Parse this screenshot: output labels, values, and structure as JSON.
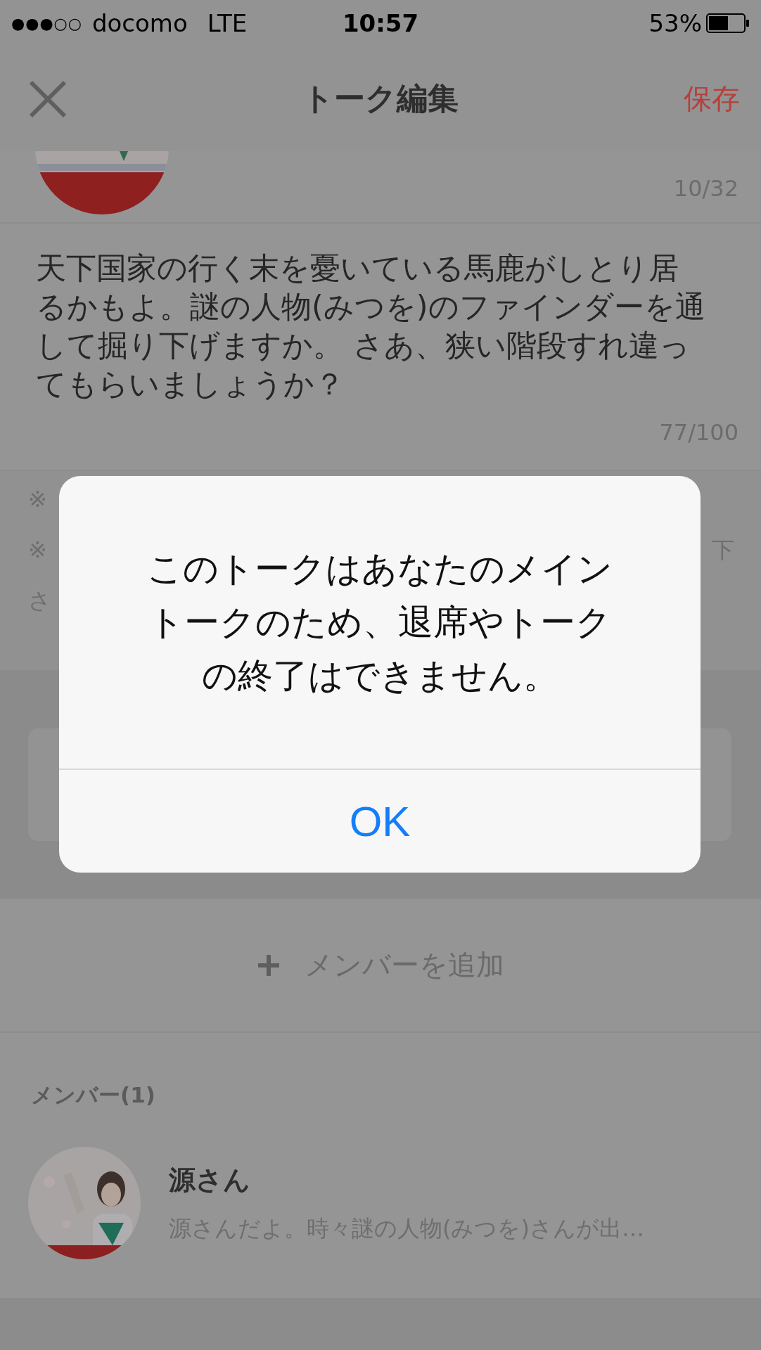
{
  "status_bar": {
    "signal": "●●●○○",
    "carrier": "docomo",
    "network": "LTE",
    "time": "10:57",
    "battery": "53%"
  },
  "nav": {
    "title": "トーク編集",
    "save": "保存"
  },
  "talk_name": {
    "counter": "10/32"
  },
  "description": {
    "text": "天下国家の行く末を憂いている馬鹿がしとり居るかもよ。謎の人物(みつを)のファインダーを通して掘り下げますか。 さあ、狭い階段すれ違ってもらいましょうか？",
    "counter": "77/100"
  },
  "notes": [
    {
      "left": "※"
    },
    {
      "left": "※",
      "right": "下"
    },
    {
      "left": "さ"
    }
  ],
  "add_member": {
    "label": "メンバーを追加"
  },
  "members": {
    "heading": "メンバー(1)",
    "items": [
      {
        "name": "源さん",
        "status": "源さんだよ。時々謎の人物(みつを)さんが出…"
      }
    ]
  },
  "alert": {
    "message": "このトークはあなたのメイントークのため、退席やトークの終了はできません。",
    "button": "OK"
  }
}
